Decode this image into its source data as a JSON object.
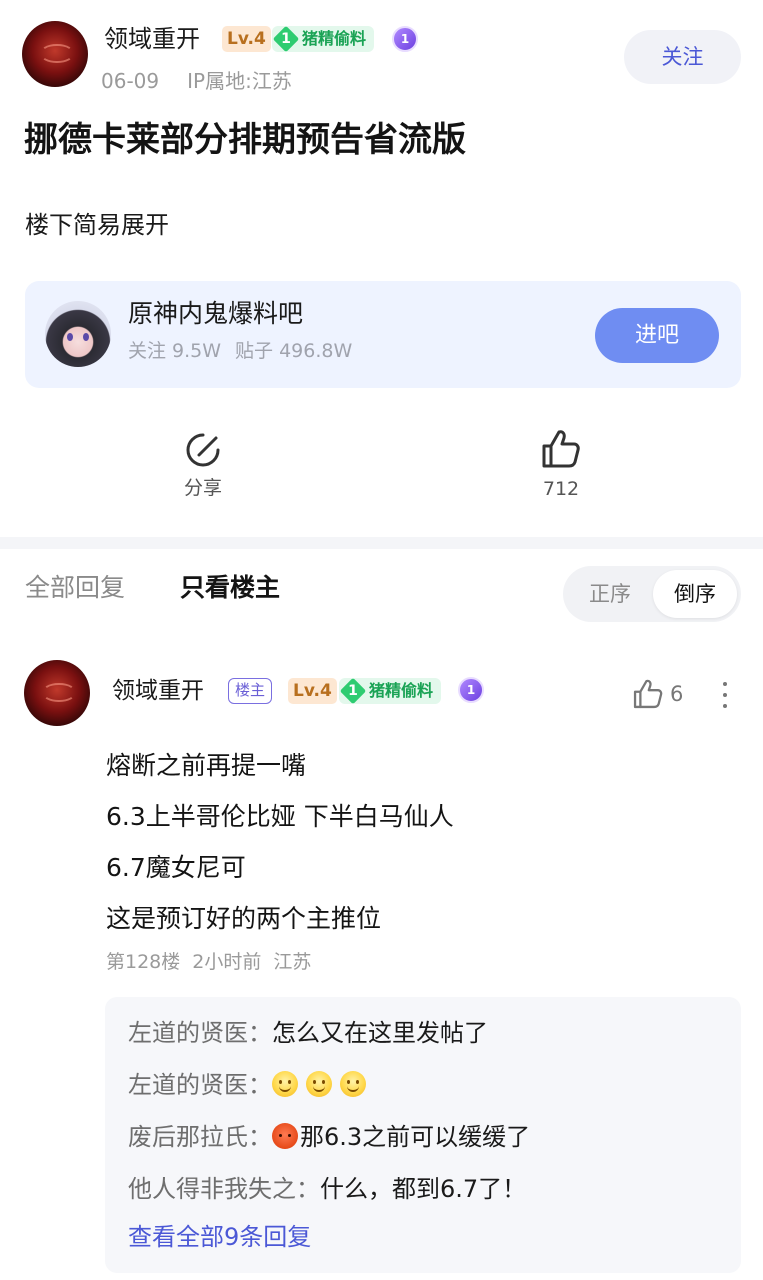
{
  "post": {
    "author": "领域重开",
    "level": "Lv.4",
    "fan_level": "1",
    "fan_title": "猪精偷料",
    "medal": "1",
    "date": "06-09",
    "ip": "IP属地:江苏",
    "follow_label": "关注",
    "title": "挪德卡莱部分排期预告省流版",
    "body": "楼下简易展开"
  },
  "forum": {
    "name": "原神内鬼爆料吧",
    "followers": "关注 9.5W",
    "posts": "贴子 496.8W",
    "enter_label": "进吧"
  },
  "actions": {
    "share_label": "分享",
    "like_count": "712"
  },
  "tabs": {
    "all_replies": "全部回复",
    "op_only": "只看楼主",
    "sort_asc": "正序",
    "sort_desc": "倒序",
    "active_tab": "只看楼主",
    "active_sort": "倒序"
  },
  "reply": {
    "author": "领域重开",
    "op_tag": "楼主",
    "level": "Lv.4",
    "fan_level": "1",
    "fan_title": "猪精偷料",
    "medal": "1",
    "like_count": "6",
    "lines": [
      "熔断之前再提一嘴",
      "6.3上半哥伦比娅 下半白马仙人",
      "6.7魔女尼可",
      "这是预订好的两个主推位"
    ],
    "floor": "第128楼",
    "time": "2小时前",
    "location": "江苏"
  },
  "sub_replies": [
    {
      "author": "左道的贤医：",
      "text": "怎么又在这里发帖了",
      "emoji": ""
    },
    {
      "author": "左道的贤医：",
      "text": "",
      "emoji": "smile-x3"
    },
    {
      "author": "废后那拉氏：",
      "text": "那6.3之前可以缓缓了",
      "emoji": "angry"
    },
    {
      "author": "他人得非我失之：",
      "text": "什么，都到6.7了！",
      "emoji": ""
    }
  ],
  "view_all_label": "查看全部9条回复",
  "colors": {
    "accent": "#4b58d6",
    "enter_button": "#6f8df2",
    "forum_card_bg": "#eef3ff",
    "level_badge_bg": "#fde7d2",
    "fan_badge_bg": "#e3f8ec"
  }
}
